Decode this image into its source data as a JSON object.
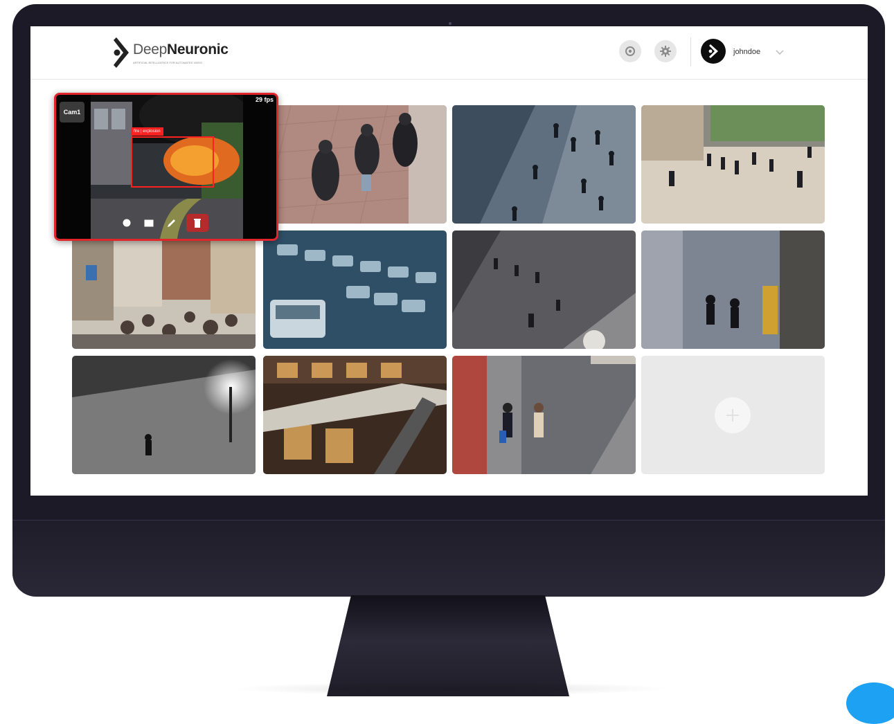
{
  "app": {
    "brand_light": "Deep",
    "brand_bold": "Neuronic",
    "tagline": "ARTIFICIAL INTELLIGENCE FOR AUTOMATED VIDEO",
    "username": "johndoe",
    "accent_color": "#e0262a"
  },
  "header": {
    "icons": [
      "circle-icon",
      "gear-icon",
      "chevron-down-icon"
    ]
  },
  "popup": {
    "camera_button_label": "Cam1",
    "fps_label": "29 fps",
    "detection_label": "fire | explosion",
    "toolbar_icons": [
      "info-icon",
      "fullscreen-icon",
      "edit-icon",
      "delete-icon"
    ]
  },
  "grid": {
    "add_camera_icon": "plus-icon"
  }
}
